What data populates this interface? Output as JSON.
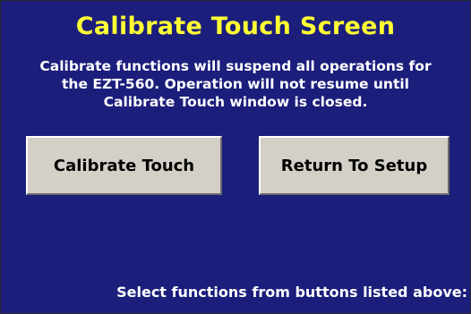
{
  "window": {
    "title": "Calibrate Touch Screen"
  },
  "description": {
    "line1": "Calibrate functions will suspend all operations for",
    "line2": "the EZT-560. Operation will not resume until",
    "line3": "Calibrate Touch window is closed."
  },
  "buttons": {
    "calibrate_label": "Calibrate Touch",
    "return_label": "Return To Setup"
  },
  "footer": {
    "instruction": "Select functions from buttons listed above:"
  },
  "colors": {
    "background": "#1c1e7c",
    "title": "#ffff33",
    "text": "#ffffff",
    "button_face": "#d4d0c8"
  }
}
